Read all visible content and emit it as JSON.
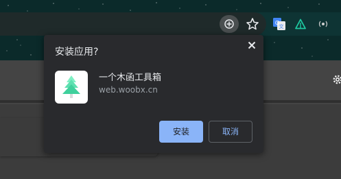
{
  "dialog": {
    "title": "安装应用?",
    "app_name": "一个木函工具箱",
    "app_origin": "web.woobx.cn",
    "install_label": "安装",
    "cancel_label": "取消",
    "close_icon": "close-icon",
    "app_icon": "tree-icon"
  },
  "toolbar": {
    "icons": [
      "install-app-icon",
      "star-icon",
      "translate-extension-icon",
      "triangle-extension-icon",
      "media-extension-icon"
    ]
  },
  "colors": {
    "dialog_bg": "#292a2d",
    "primary_button": "#8ab4f8",
    "text_primary": "#e8eaed",
    "text_secondary": "#9aa0a6",
    "toolbar_bg": "#0e3434",
    "tree_accent": "#5de0b0"
  }
}
